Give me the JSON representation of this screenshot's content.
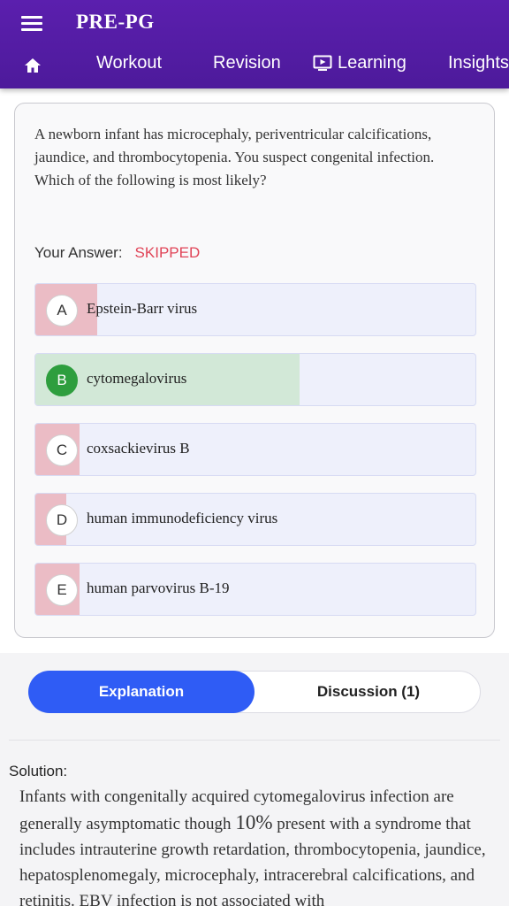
{
  "app": {
    "title": "PRE-PG"
  },
  "nav": {
    "items": [
      {
        "label": "Workout"
      },
      {
        "label": "Revision"
      },
      {
        "label": "Learning"
      },
      {
        "label": "Insights"
      }
    ]
  },
  "question": {
    "text": "A newborn infant has microcephaly, periventricular calcifications, jaundice, and thrombocytopenia. You suspect congenital infection. Which of the following is most likely?",
    "answer_label": "Your Answer:",
    "answer_value": "SKIPPED"
  },
  "options": [
    {
      "letter": "A",
      "text": "Epstein-Barr virus",
      "percent": 14,
      "correct": false
    },
    {
      "letter": "B",
      "text": "cytomegalovirus",
      "percent": 60,
      "correct": true
    },
    {
      "letter": "C",
      "text": "coxsackievirus B",
      "percent": 10,
      "correct": false
    },
    {
      "letter": "D",
      "text": "human immunodeficiency virus",
      "percent": 7,
      "correct": false
    },
    {
      "letter": "E",
      "text": "human parvovirus B-19",
      "percent": 10,
      "correct": false
    }
  ],
  "tabs": {
    "explanation": "Explanation",
    "discussion": "Discussion (1)"
  },
  "solution": {
    "label": "Solution:",
    "text_before": "Infants with congenitally acquired cytomegalovirus infection are generally asymptomatic though ",
    "percent": "10%",
    "text_after": " present with a syndrome that includes intrauterine growth retardation, thrombocytopenia, jaundice, hepatosplenomegaly, microcephaly, intracerebral calcifications, and retinitis. EBV infection is not associated with"
  },
  "colors": {
    "primary": "#5b1fae",
    "accent": "#2f5cf5",
    "wrong_fill": "#ebbcc5",
    "correct_fill": "#d2e8d7",
    "skipped": "#e04457",
    "correct_badge": "#2e9e3e"
  }
}
